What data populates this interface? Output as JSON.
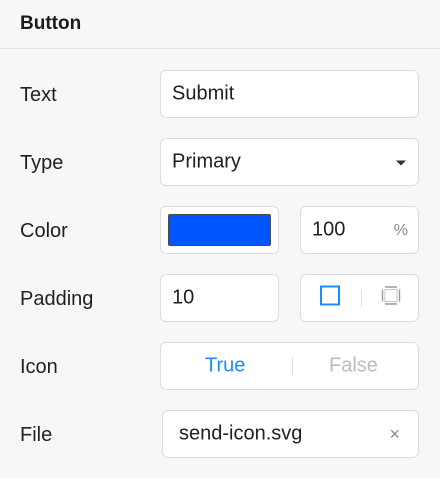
{
  "panel": {
    "title": "Button"
  },
  "rows": {
    "text": {
      "label": "Text",
      "value": "Submit"
    },
    "type": {
      "label": "Type",
      "value": "Primary"
    },
    "color": {
      "label": "Color",
      "swatch": "#0057ff",
      "opacity": "100",
      "unit": "%"
    },
    "padding": {
      "label": "Padding",
      "value": "10",
      "mode_active": "all-sides-icon",
      "mode_inactive": "individual-sides-icon"
    },
    "icon": {
      "label": "Icon",
      "true_label": "True",
      "false_label": "False",
      "selected": "True"
    },
    "file": {
      "label": "File",
      "value": "send-icon.svg",
      "clear": "×"
    }
  },
  "colors": {
    "accent": "#1a8cff",
    "muted": "#bcbcbc",
    "border": "#dcdcdc"
  }
}
